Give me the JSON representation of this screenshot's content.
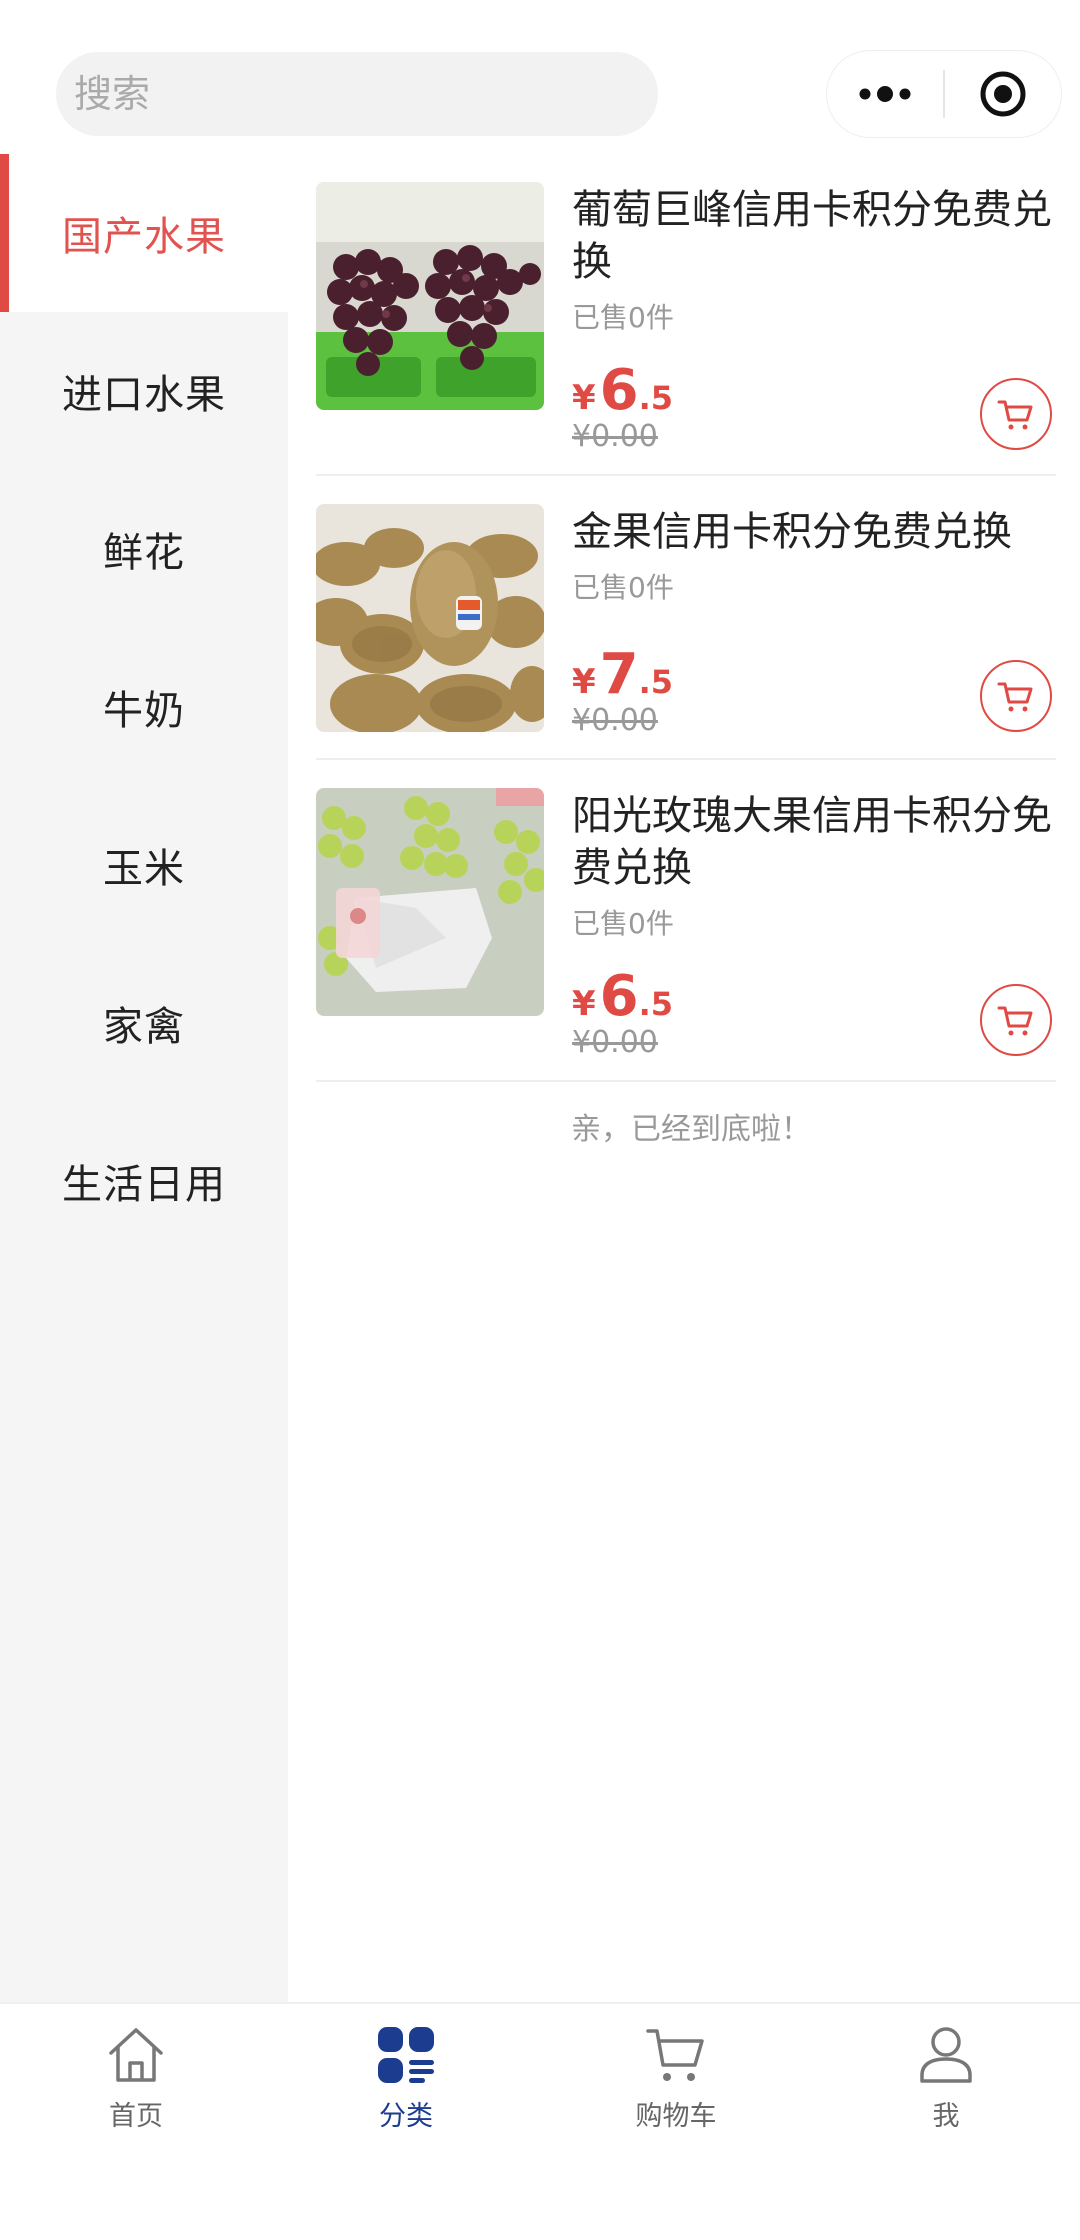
{
  "search": {
    "placeholder": "搜索"
  },
  "sidebar": {
    "items": [
      {
        "label": "国产水果",
        "active": true
      },
      {
        "label": "进口水果",
        "active": false
      },
      {
        "label": "鲜花",
        "active": false
      },
      {
        "label": "牛奶",
        "active": false
      },
      {
        "label": "玉米",
        "active": false
      },
      {
        "label": "家禽",
        "active": false
      },
      {
        "label": "生活日用",
        "active": false
      }
    ]
  },
  "products": [
    {
      "title": "葡萄巨峰信用卡积分免费兑换",
      "sold": "已售0件",
      "currency": "¥",
      "price_int": "6",
      "price_dec": ".5",
      "original": "¥0.00",
      "image": "grapes-photo"
    },
    {
      "title": "金果信用卡积分免费兑换",
      "sold": "已售0件",
      "currency": "¥",
      "price_int": "7",
      "price_dec": ".5",
      "original": "¥0.00",
      "image": "kiwi-photo"
    },
    {
      "title": "阳光玫瑰大果信用卡积分免费兑换",
      "sold": "已售0件",
      "currency": "¥",
      "price_int": "6",
      "price_dec": ".5",
      "original": "¥0.00",
      "image": "green-grapes-photo"
    }
  ],
  "end_tip": "亲，已经到底啦！",
  "tabbar": {
    "tabs": [
      {
        "label": "首页",
        "icon": "home-icon",
        "active": false
      },
      {
        "label": "分类",
        "icon": "category-icon",
        "active": true
      },
      {
        "label": "购物车",
        "icon": "cart-icon",
        "active": false
      },
      {
        "label": "我",
        "icon": "user-icon",
        "active": false
      }
    ]
  },
  "colors": {
    "accent": "#e04a44",
    "tab_active": "#1b3c8f",
    "sidebar_bg": "#f5f5f5"
  }
}
